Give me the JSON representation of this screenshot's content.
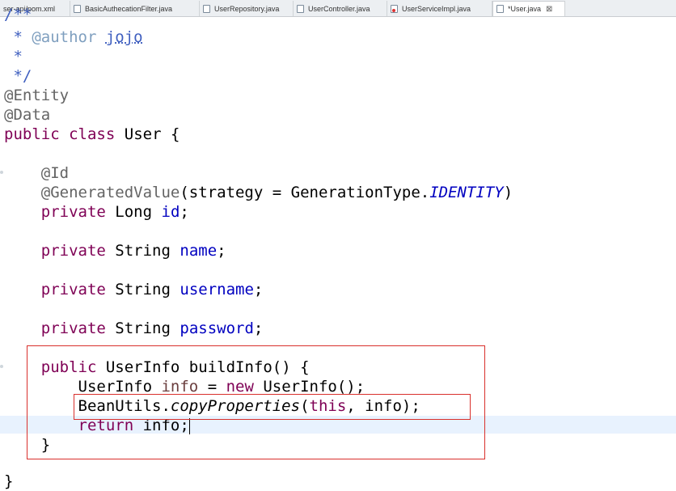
{
  "tabs": [
    {
      "label": "ser-api/pom.xml",
      "icon": "xml-file-icon",
      "active": false
    },
    {
      "label": "BasicAuthecationFilter.java",
      "icon": "java-file-icon",
      "active": false
    },
    {
      "label": "UserRepository.java",
      "icon": "java-file-icon",
      "active": false
    },
    {
      "label": "UserController.java",
      "icon": "java-file-icon",
      "active": false
    },
    {
      "label": "UserServiceImpl.java",
      "icon": "java-file-error-icon",
      "active": false
    },
    {
      "label": "*User.java",
      "icon": "java-file-icon",
      "active": true,
      "close": "⊠"
    }
  ],
  "code": {
    "comment_top": "/**",
    "author_tag": "@author",
    "author_name": "jojo",
    "comment_star": "*",
    "comment_end": "*/",
    "ann_entity": "@Entity",
    "ann_data": "@Data",
    "kw_public": "public",
    "kw_class": "class",
    "class_name": "User",
    "brace_open": "{",
    "ann_id": "@Id",
    "ann_generated": "@GeneratedValue",
    "strategy_text": "(strategy = GenerationType.",
    "identity": "IDENTITY",
    "paren_close": ")",
    "kw_private": "private",
    "type_long": "Long",
    "type_string": "String",
    "field_id": "id",
    "field_name": "name",
    "field_username": "username",
    "field_password": "password",
    "semicolon": ";",
    "method_sig": "UserInfo buildInfo() {",
    "local_type": "UserInfo",
    "local_var": "info",
    "assign": " = ",
    "kw_new": "new",
    "ctor": "UserInfo();",
    "beanutils": "BeanUtils.",
    "copy_props": "copyProperties",
    "copy_open": "(",
    "kw_this": "this",
    "copy_rest": ", info);",
    "kw_return": "return",
    "return_rest": "info;",
    "method_close": "}",
    "class_close": "}"
  },
  "colors": {
    "keyword": "#7f0055",
    "annotation": "#646464",
    "comment": "#3f5fbf",
    "field": "#0000c0",
    "highlight_box": "#d9302c",
    "current_line": "#e8f2fe"
  }
}
